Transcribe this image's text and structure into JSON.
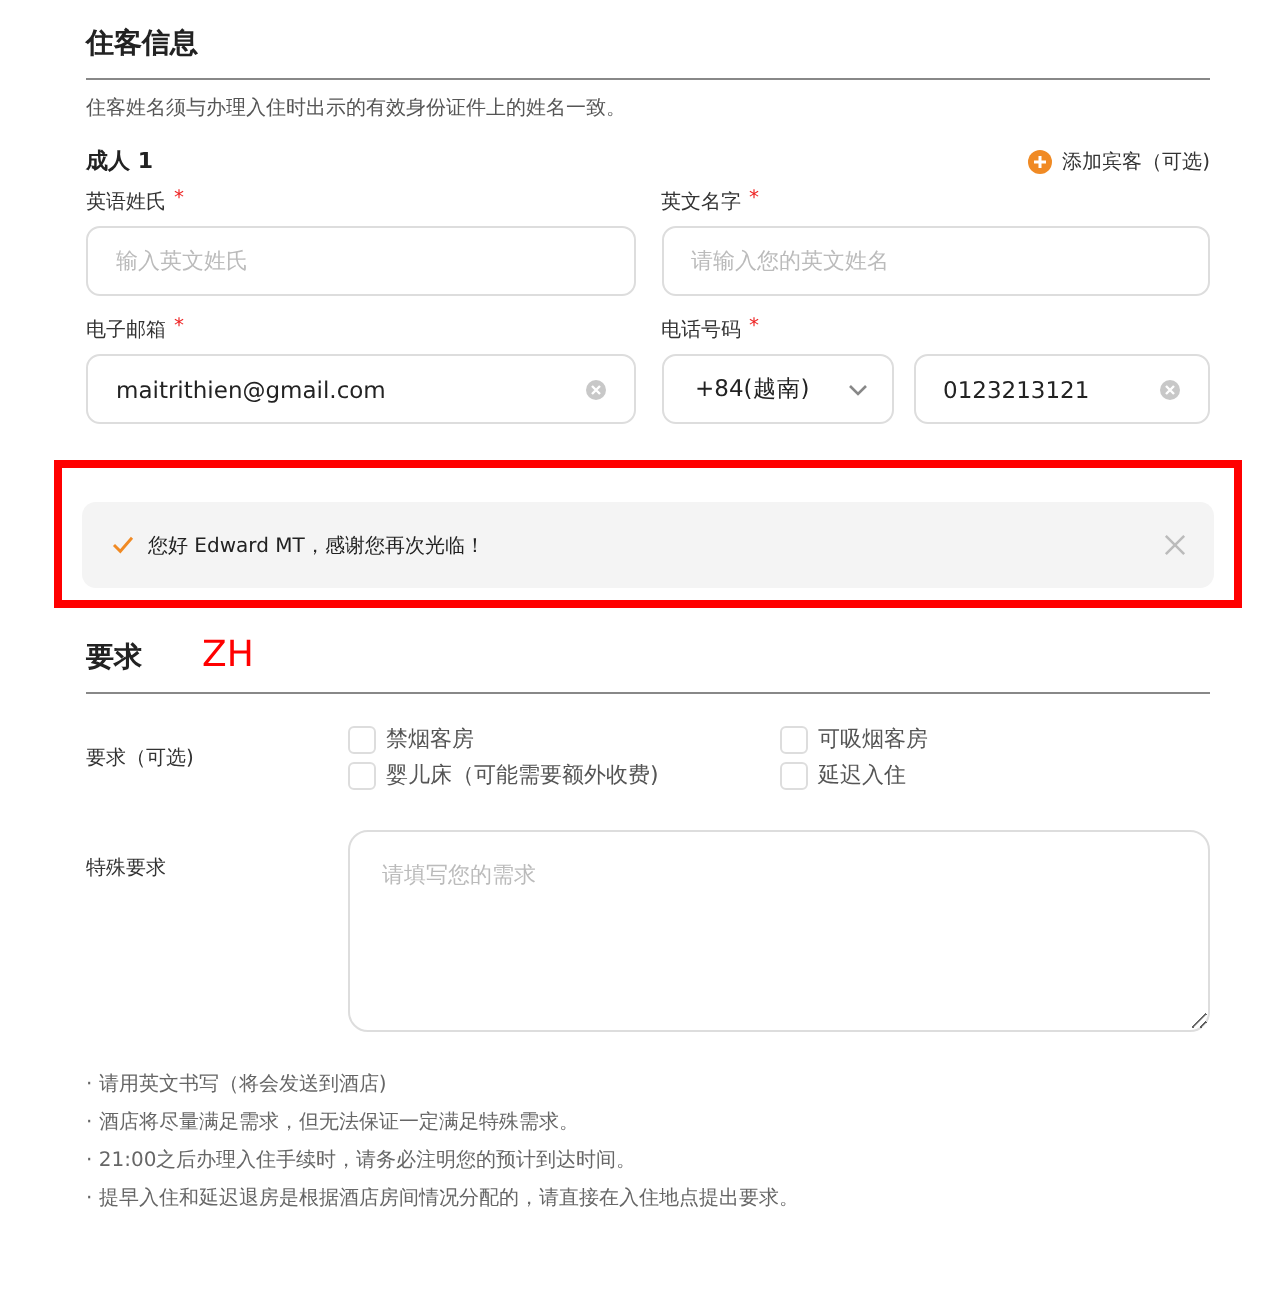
{
  "guest_section": {
    "title": "住客信息",
    "note": "住客姓名须与办理入住时出示的有效身份证件上的姓名一致。",
    "adult_label": "成人 1",
    "add_guest": "添加宾客（可选)",
    "fields": [
      {
        "kind": "input",
        "label": "英语姓氏",
        "required_mark": "*",
        "placeholder": "输入英文姓氏"
      },
      {
        "kind": "input",
        "label": "英文名字",
        "required_mark": "*",
        "placeholder": "请输入您的英文姓名"
      },
      {
        "kind": "input",
        "label": "电子邮箱",
        "required_mark": "*",
        "value": "maitrithien@gmail.com",
        "clearable": true
      },
      {
        "kind": "phone",
        "label": "电话号码",
        "required_mark": "*",
        "code": "+84(越南)",
        "value": "0123213121",
        "clearable": true
      }
    ]
  },
  "welcome_banner": {
    "text": "您好 Edward MT，感谢您再次光临！",
    "highlighted": true
  },
  "annotation": {
    "text": "ZH"
  },
  "requests_section": {
    "title": "要求",
    "options_label": "要求（可选)",
    "options": [
      {
        "label": "禁烟客房",
        "checked": false
      },
      {
        "label": "可吸烟客房",
        "checked": false
      },
      {
        "label": "婴儿床（可能需要额外收费)",
        "checked": false
      },
      {
        "label": "延迟入住",
        "checked": false
      }
    ],
    "special_label": "特殊要求",
    "special_placeholder": "请填写您的需求",
    "notes": [
      "· 请用英文书写（将会发送到酒店)",
      "· 酒店将尽量满足需求，但无法保证一定满足特殊需求。",
      "· 21:00之后办理入住手续时，请务必注明您的预计到达时间。",
      "· 提早入住和延迟退房是根据酒店房间情况分配的，请直接在入住地点提出要求。"
    ]
  }
}
